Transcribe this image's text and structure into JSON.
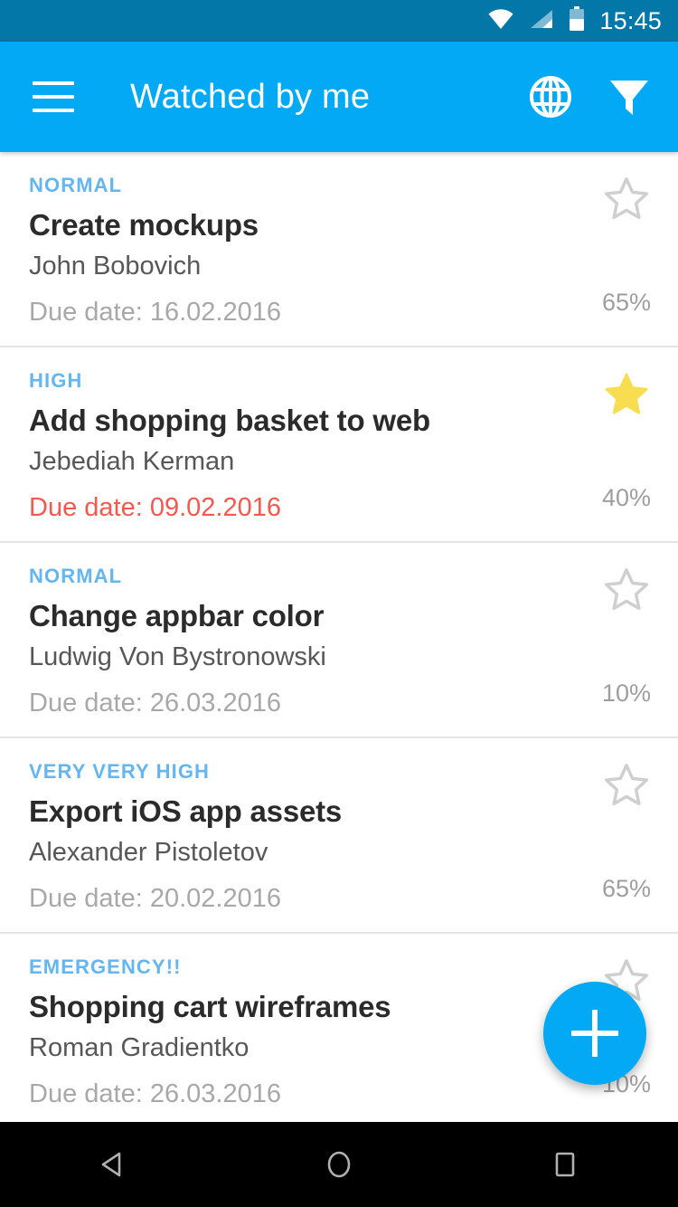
{
  "status_bar": {
    "time": "15:45",
    "icons": [
      "wifi-icon",
      "cell-signal-icon",
      "battery-icon"
    ],
    "background_color": "#0377a8"
  },
  "app_bar": {
    "title": "Watched by me",
    "menu_icon": "hamburger-menu-icon",
    "actions": [
      {
        "name": "globe-icon",
        "label": "Globe"
      },
      {
        "name": "filter-icon",
        "label": "Filter"
      }
    ],
    "background_color": "#03a9f4",
    "text_color": "#ffffff"
  },
  "colors": {
    "priority": "#64b5f0",
    "title": "#2b2b2b",
    "assignee": "#575757",
    "due_normal": "#a8a8a8",
    "due_overdue": "#f4584f",
    "star_filled": "#f7dd4f",
    "star_empty": "#cfcfcf",
    "progress": "#9e9e9e",
    "divider": "#e6e6e6"
  },
  "list": {
    "items": [
      {
        "priority": "NORMAL",
        "title": "Create mockups",
        "assignee": "John Bobovich",
        "due_date": "Due date: 16.02.2016",
        "overdue": false,
        "progress": "65%",
        "starred": false
      },
      {
        "priority": "HIGH",
        "title": "Add shopping basket to web",
        "assignee": "Jebediah Kerman",
        "due_date": "Due date: 09.02.2016",
        "overdue": true,
        "progress": "40%",
        "starred": true
      },
      {
        "priority": "NORMAL",
        "title": "Change appbar color",
        "assignee": "Ludwig Von Bystronowski",
        "due_date": "Due date: 26.03.2016",
        "overdue": false,
        "progress": "10%",
        "starred": false
      },
      {
        "priority": "VERY VERY HIGH",
        "title": "Export iOS app assets",
        "assignee": "Alexander Pistoletov",
        "due_date": "Due date: 20.02.2016",
        "overdue": false,
        "progress": "65%",
        "starred": false
      },
      {
        "priority": "EMERGENCY!!",
        "title": "Shopping cart wireframes",
        "assignee": "Roman Gradientko",
        "due_date": "Due date: 26.03.2016",
        "overdue": false,
        "progress": "10%",
        "starred": false
      }
    ]
  },
  "fab": {
    "icon": "plus-icon",
    "label": "Add",
    "color": "#03a9f4"
  },
  "nav_bar": {
    "buttons": [
      {
        "name": "back-button",
        "label": "Back"
      },
      {
        "name": "home-button",
        "label": "Home"
      },
      {
        "name": "recents-button",
        "label": "Recents"
      }
    ]
  }
}
